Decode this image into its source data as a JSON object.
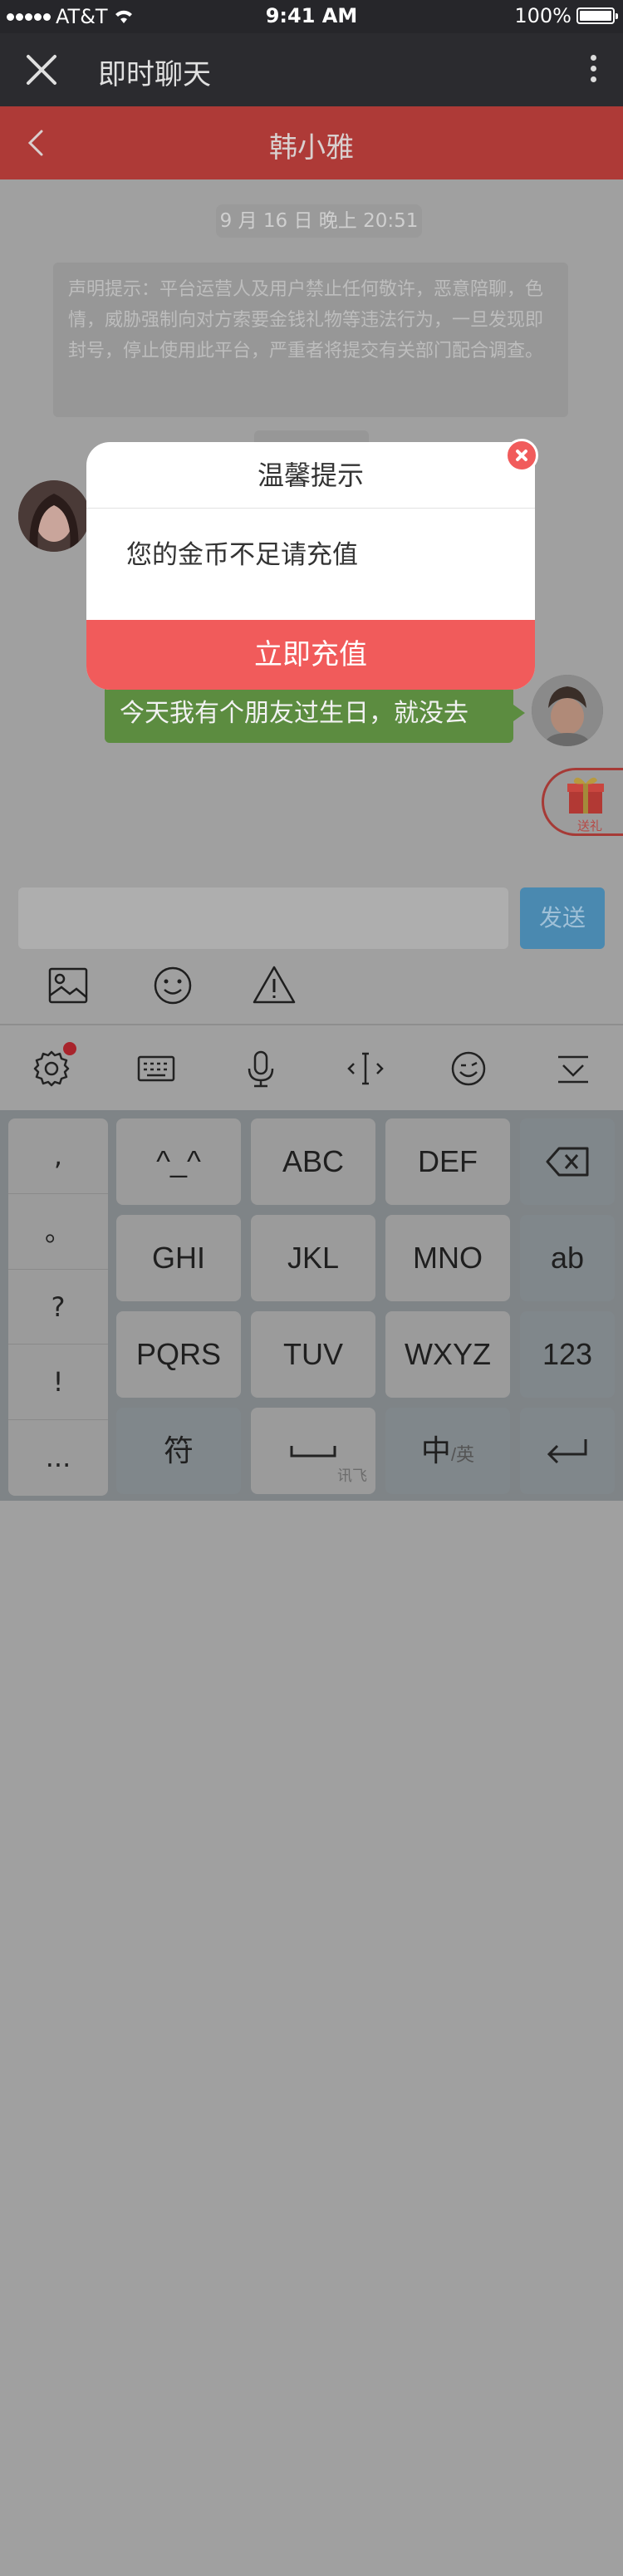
{
  "status_bar": {
    "carrier": "AT&T",
    "time": "9:41 AM",
    "battery": "100%"
  },
  "app_header": {
    "title": "即时聊天",
    "close_icon": "close-icon",
    "more_icon": "more-vertical-icon"
  },
  "chat": {
    "contact_name": "韩小雅",
    "time_label": "9 月 16 日 晚上 20:51",
    "notice": "声明提示：平台运营人及用户禁止任何敬许，恶意陪聊，色情，威胁强制向对方索要金钱礼物等违法行为，一旦发现即封号，停止使用此平台，严重者将提交有关部门配合调查。",
    "my_message": "今天我有个朋友过生日，就没去",
    "gift_label": "送礼"
  },
  "input_bar": {
    "input_value": "",
    "send_label": "发送"
  },
  "ime": {
    "symbols": [
      ",",
      "。",
      "?",
      "!",
      "..."
    ],
    "row1": [
      "^_^",
      "ABC",
      "DEF"
    ],
    "row2": [
      "GHI",
      "JKL",
      "MNO"
    ],
    "row3": [
      "PQRS",
      "TUV",
      "WXYZ"
    ],
    "ab_label": "ab",
    "num_label": "123",
    "fu_label": "符",
    "space_sub": "讯飞",
    "lang_main": "中",
    "lang_sub": "/英"
  },
  "modal": {
    "title": "温馨提示",
    "message": "您的金币不足请充值",
    "button": "立即充值"
  },
  "colors": {
    "accent_red": "#f15b5b",
    "send_blue": "#4a89b0",
    "bubble_green": "#5c8c40"
  }
}
